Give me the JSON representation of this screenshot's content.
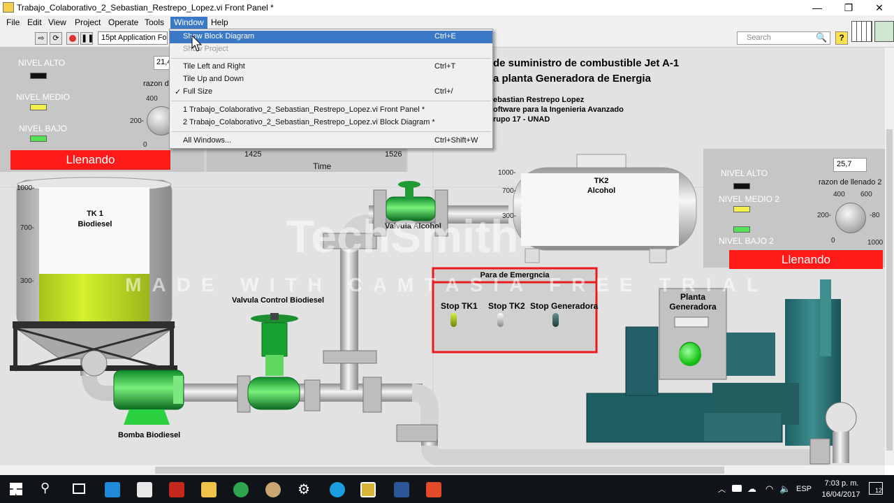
{
  "window": {
    "title": "Trabajo_Colaborativo_2_Sebastian_Restrepo_Lopez.vi Front Panel *",
    "minimize": "—",
    "maximize": "❐",
    "close": "✕"
  },
  "menubar": [
    "File",
    "Edit",
    "View",
    "Project",
    "Operate",
    "Tools",
    "Window",
    "Help"
  ],
  "toolbar": {
    "font": "15pt Application Fo",
    "search_placeholder": "Search",
    "help": "?"
  },
  "window_menu": [
    {
      "label": "Show Block Diagram",
      "shortcut": "Ctrl+E",
      "state": "highlighted"
    },
    {
      "label": "Show Project",
      "shortcut": "",
      "state": "disabled"
    },
    {
      "label": "Tile Left and Right",
      "shortcut": "Ctrl+T"
    },
    {
      "label": "Tile Up and Down",
      "shortcut": ""
    },
    {
      "label": "Full Size",
      "shortcut": "Ctrl+/",
      "checked": true
    },
    {
      "label": "1 Trabajo_Colaborativo_2_Sebastian_Restrepo_Lopez.vi Front Panel *",
      "shortcut": ""
    },
    {
      "label": "2 Trabajo_Colaborativo_2_Sebastian_Restrepo_Lopez.vi Block Diagram *",
      "shortcut": ""
    },
    {
      "label": "All Windows...",
      "shortcut": "Ctrl+Shift+W"
    }
  ],
  "header": {
    "title_line1": "de suministro de combustible Jet A-1",
    "title_line2": "a planta Generadora de Energia",
    "author": "ebastian Restrepo Lopez",
    "course": "oftware para la Ingenieria Avanzado",
    "group": "rupo 17 -  UNAD"
  },
  "tank1_panel": {
    "nivel_alto": "NIVEL ALTO",
    "nivel_medio": "NIVEL MEDIO",
    "nivel_bajo": "NIVEL BAJO",
    "value_display": "21,4",
    "razon": "razon d",
    "knob_400": "400",
    "knob_200": "200-",
    "knob_0": "0",
    "status": "Llenando"
  },
  "chart_strip": {
    "x_start": "1425",
    "x_end": "1526",
    "xlabel": "Time"
  },
  "tank1": {
    "name": "TK 1",
    "liquid": "Biodiesel",
    "ticks": [
      "1000-",
      "700-",
      "300-"
    ],
    "fill_level": 0.45
  },
  "tank2": {
    "name": "TK2",
    "liquid": "Alcohol",
    "ticks": [
      "1000-",
      "700-",
      "300-"
    ]
  },
  "tank2_panel": {
    "value_display": "25,7",
    "nivel_alto": "NIVEL ALTO",
    "razon": "razon de llenado 2",
    "knob_400": "400",
    "knob_600": "600",
    "knob_200": "200-",
    "knob_80": "-80",
    "nivel_medio": "NIVEL MEDIO 2",
    "nivel_bajo": "NIVEL BAJO 2",
    "knob_0": "0",
    "knob_1000": "1000",
    "status": "Llenando"
  },
  "valves": {
    "alcohol": "Valvula Alcohol",
    "biodiesel": "Valvula Control Biodiesel"
  },
  "pump": "Bomba Biodiesel",
  "emergency": {
    "title": "Para de Emergncia",
    "stop_tk1": "Stop TK1",
    "stop_tk2": "Stop TK2",
    "stop_gen": "Stop Generadora"
  },
  "generator": {
    "label_line1": "Planta",
    "label_line2": "Generadora"
  },
  "watermark": {
    "techsmith": "TechSmith",
    "banner": "MADE WITH CAMTASIA FREE TRIAL"
  },
  "taskbar": {
    "time": "7:03 p. m.",
    "date": "16/04/2017",
    "lang": "ESP",
    "notif": "12"
  },
  "colors": {
    "accent": "#3b78c5",
    "status_red": "#ff1a1a",
    "led_green": "#55e055",
    "led_yellow": "#f2f04a",
    "tank_fluid": "#c8e82a"
  }
}
